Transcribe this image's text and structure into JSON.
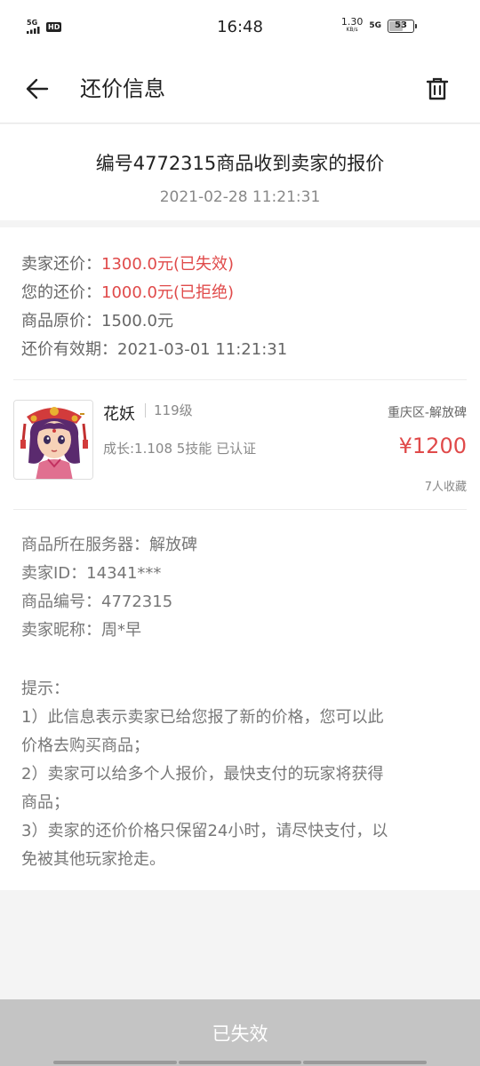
{
  "status_bar": {
    "signal_label": "5G",
    "hd": "HD",
    "time": "16:48",
    "speed_value": "1.30",
    "speed_unit": "KB/s",
    "network": "5G",
    "battery": "53"
  },
  "nav": {
    "title": "还价信息",
    "back_icon": "arrow-left-icon",
    "delete_icon": "trash-icon"
  },
  "header": {
    "title": "编号4772315商品收到卖家的报价",
    "datetime": "2021-02-28 11:21:31"
  },
  "offer": {
    "seller_label": "卖家还价：",
    "seller_value": "1300.0元(已失效)",
    "your_label": "您的还价：",
    "your_value": "1000.0元(已拒绝)",
    "original_label": "商品原价：",
    "original_value": "1500.0元",
    "valid_label": "还价有效期：",
    "valid_value": "2021-03-01 11:21:31"
  },
  "product": {
    "name": "花妖",
    "level": "119级",
    "region": "重庆区-解放碑",
    "attrs": "成长:1.108 5技能 已认证",
    "price": "¥1200",
    "favorites": "7人收藏"
  },
  "details": {
    "server": "商品所在服务器：解放碑",
    "seller_id": "卖家ID：14341***",
    "item_no": "商品编号：4772315",
    "seller_nick": "卖家昵称：周*早"
  },
  "tips": {
    "title": "提示：",
    "lines": [
      "1）此信息表示卖家已给您报了新的价格，您可以此",
      "价格去购买商品；",
      "2）卖家可以给多个人报价，最快支付的玩家将获得",
      "商品；",
      "3）卖家的还价价格只保留24小时，请尽快支付，以",
      "免被其他玩家抢走。"
    ]
  },
  "bottom": {
    "button_label": "已失效"
  },
  "colors": {
    "accent_red": "#e04a4a",
    "disabled_button": "#c4c4c4"
  }
}
